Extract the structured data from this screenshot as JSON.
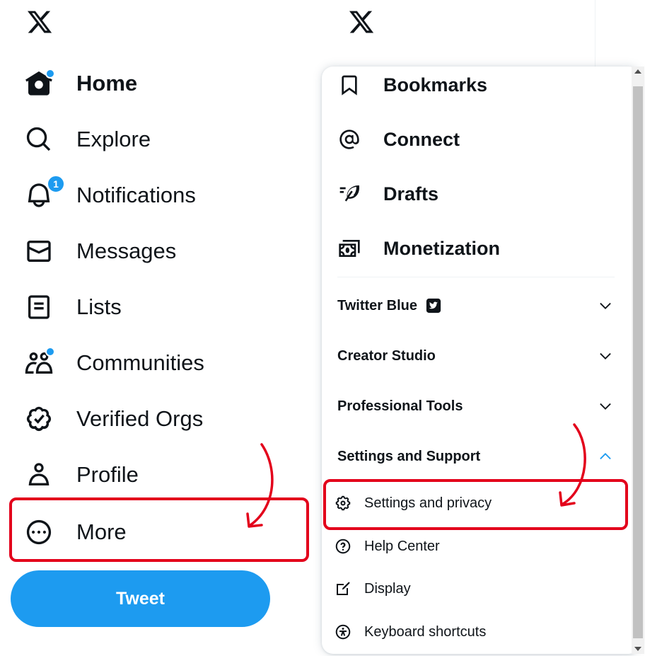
{
  "left_nav": {
    "items": [
      {
        "label": "Home",
        "icon": "home-icon",
        "active": true
      },
      {
        "label": "Explore",
        "icon": "search-icon"
      },
      {
        "label": "Notifications",
        "icon": "bell-icon",
        "badge": "1"
      },
      {
        "label": "Messages",
        "icon": "mail-icon"
      },
      {
        "label": "Lists",
        "icon": "list-icon"
      },
      {
        "label": "Communities",
        "icon": "communities-icon"
      },
      {
        "label": "Verified Orgs",
        "icon": "verified-icon"
      },
      {
        "label": "Profile",
        "icon": "person-icon"
      },
      {
        "label": "More",
        "icon": "more-circle-icon"
      }
    ],
    "tweet_button": "Tweet"
  },
  "dropdown": {
    "top_items": [
      {
        "label": "Bookmarks",
        "icon": "bookmark-icon"
      },
      {
        "label": "Connect",
        "icon": "at-icon"
      },
      {
        "label": "Drafts",
        "icon": "feather-icon"
      },
      {
        "label": "Monetization",
        "icon": "money-icon"
      }
    ],
    "sections": [
      {
        "label": "Twitter Blue",
        "expanded": false
      },
      {
        "label": "Creator Studio",
        "expanded": false
      },
      {
        "label": "Professional Tools",
        "expanded": false
      },
      {
        "label": "Settings and Support",
        "expanded": true
      }
    ],
    "support_items": [
      {
        "label": "Settings and privacy",
        "icon": "gear-icon"
      },
      {
        "label": "Help Center",
        "icon": "help-icon"
      },
      {
        "label": "Display",
        "icon": "display-edit-icon"
      },
      {
        "label": "Keyboard shortcuts",
        "icon": "accessibility-icon"
      }
    ]
  },
  "colors": {
    "accent": "#1d9bf0",
    "annotation": "#e3001b",
    "text": "#0f1419"
  }
}
